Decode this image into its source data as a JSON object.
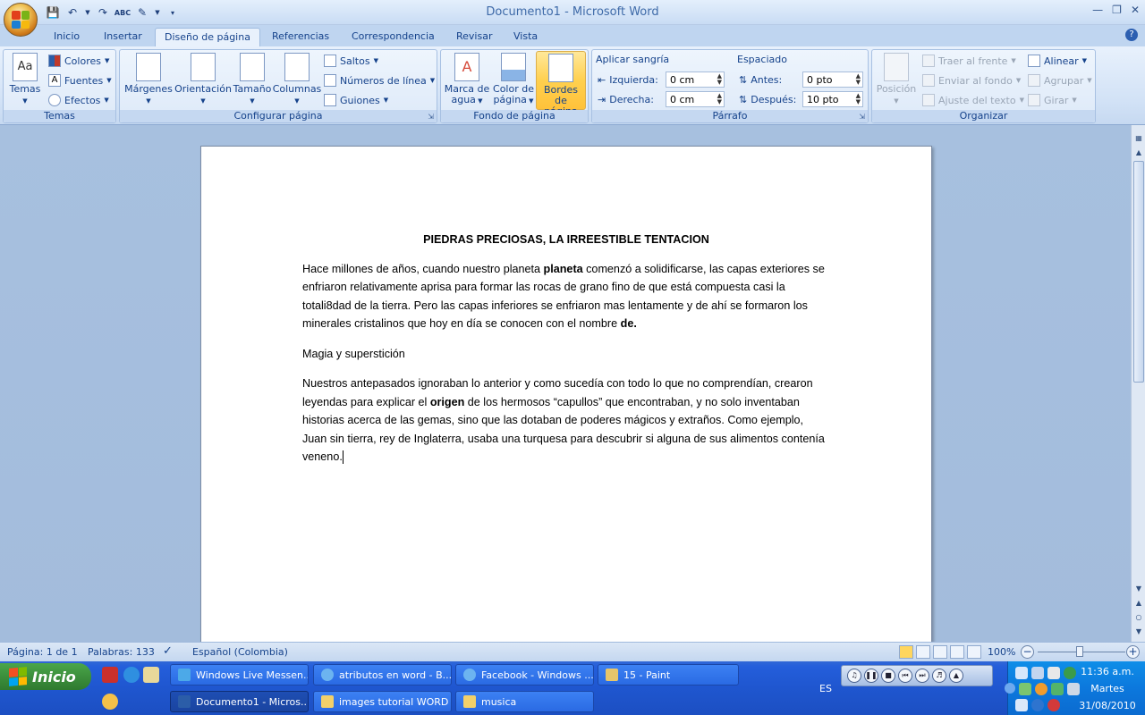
{
  "window": {
    "title": "Documento1 - Microsoft Word"
  },
  "quick_access": {
    "icons": [
      "save-icon",
      "undo-icon",
      "redo-icon",
      "spelling-icon",
      "format-icon",
      "customize-icon"
    ]
  },
  "tabs": [
    "Inicio",
    "Insertar",
    "Diseño de página",
    "Referencias",
    "Correspondencia",
    "Revisar",
    "Vista"
  ],
  "active_tab": "Diseño de página",
  "ribbon": {
    "temas": {
      "label": "Temas",
      "big": "Temas",
      "colores": "Colores",
      "fuentes": "Fuentes",
      "efectos": "Efectos"
    },
    "configurar": {
      "label": "Configurar página",
      "margenes": "Márgenes",
      "orientacion": "Orientación",
      "tamano": "Tamaño",
      "columnas": "Columnas",
      "saltos": "Saltos",
      "numeros": "Números de línea",
      "guiones": "Guiones"
    },
    "fondo": {
      "label": "Fondo de página",
      "marca_1": "Marca de",
      "marca_2": "agua",
      "color_1": "Color de",
      "color_2": "página",
      "bordes_1": "Bordes",
      "bordes_2": "de página"
    },
    "parrafo": {
      "label": "Párrafo",
      "sangria": "Aplicar sangría",
      "izquierda": "Izquierda:",
      "izquierda_val": "0 cm",
      "derecha": "Derecha:",
      "derecha_val": "0 cm",
      "espaciado": "Espaciado",
      "antes": "Antes:",
      "antes_val": "0 pto",
      "despues": "Después:",
      "despues_val": "10 pto"
    },
    "organizar": {
      "label": "Organizar",
      "posicion": "Posición",
      "traer": "Traer al frente",
      "enviar": "Enviar al fondo",
      "ajuste": "Ajuste del texto",
      "alinear": "Alinear",
      "agrupar": "Agrupar",
      "girar": "Girar"
    }
  },
  "document": {
    "title": "PIEDRAS PRECIOSAS, LA IRREESTIBLE TENTACION",
    "p1_a": "Hace millones de años, cuando nuestro planeta ",
    "p1_bold": "planeta",
    "p1_b": " comenzó a solidificarse, las capas exteriores se enfriaron relativamente aprisa para formar las rocas de grano fino de que está compuesta  casi la totali8dad de la tierra. Pero las capas inferiores se enfriaron mas lentamente y de ahí se formaron los minerales cristalinos  que hoy en día se conocen con el nombre ",
    "p1_bold2": "de.",
    "p2": "Magia y superstición",
    "p3_a": "Nuestros antepasados ignoraban lo anterior y como sucedía con todo lo  que no comprendían, crearon leyendas para explicar el ",
    "p3_bold": "origen",
    "p3_b": "  de los  hermosos “capullos” que encontraban, y no solo inventaban historias acerca de las gemas, sino que las dotaban de poderes mágicos y extraños. Como ejemplo, Juan sin tierra, rey de Inglaterra, usaba una turquesa para descubrir si alguna de sus alimentos contenía veneno."
  },
  "status": {
    "pagina": "Página: 1 de 1",
    "palabras": "Palabras: 133",
    "idioma": "Español (Colombia)",
    "zoom": "100%"
  },
  "taskbar": {
    "start": "Inicio",
    "row1": [
      "Windows Live Messen...",
      "atributos en word - B...",
      "Facebook - Windows ...",
      "15 - Paint"
    ],
    "row2": [
      "Documento1 - Micros...",
      "images tutorial WORD",
      "musica"
    ],
    "lang": "ES",
    "clock_time": "11:36 a.m.",
    "clock_day": "Martes",
    "clock_date": "31/08/2010"
  }
}
